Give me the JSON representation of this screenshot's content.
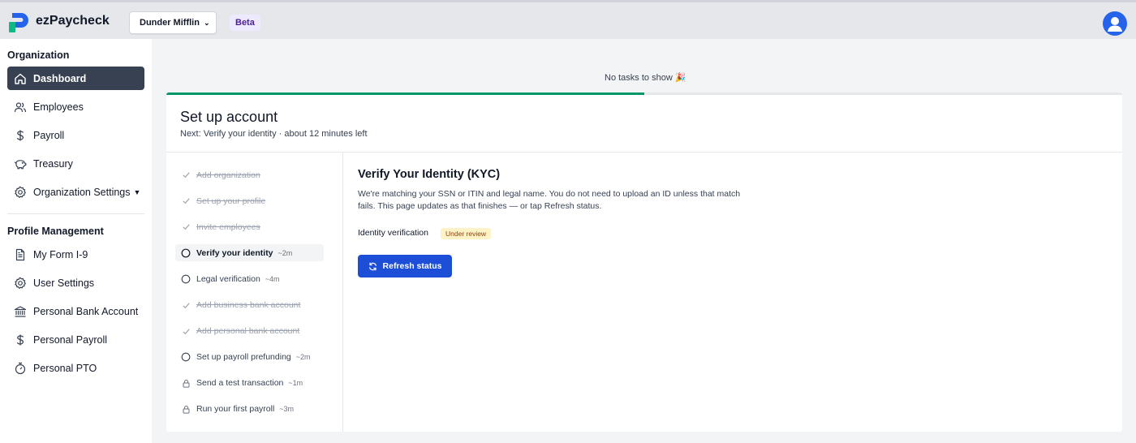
{
  "app": {
    "brand": "ezPaycheck",
    "org_select": "Dunder Mifflin",
    "beta_label": "Beta"
  },
  "colors": {
    "primary": "#1d4ed8",
    "active_nav": "#374151",
    "progress": "#059669",
    "badge_bg": "#fef3c7",
    "badge_text": "#92400e"
  },
  "sidebar": {
    "org_title": "Organization",
    "org_items": [
      {
        "label": "Dashboard",
        "icon": "home-icon"
      },
      {
        "label": "Employees",
        "icon": "users-icon"
      },
      {
        "label": "Payroll",
        "icon": "dollar-icon"
      },
      {
        "label": "Treasury",
        "icon": "piggy-bank-icon"
      },
      {
        "label": "Organization Settings",
        "icon": "gear-icon"
      }
    ],
    "profile_title": "Profile Management",
    "profile_items": [
      {
        "label": "My Form I-9",
        "icon": "document-icon"
      },
      {
        "label": "User Settings",
        "icon": "gear-icon"
      },
      {
        "label": "Personal Bank Account",
        "icon": "bank-icon"
      },
      {
        "label": "Personal Payroll",
        "icon": "dollar-icon"
      },
      {
        "label": "Personal PTO",
        "icon": "stopwatch-icon"
      }
    ]
  },
  "main": {
    "no_tasks": "No tasks to show 🎉",
    "setup": {
      "title": "Set up account",
      "subtitle": "Next: Verify your identity · about 12 minutes left",
      "progress_fraction": 0.5,
      "steps": [
        {
          "label": "Add organization",
          "status": "done",
          "time": ""
        },
        {
          "label": "Set up your profile",
          "status": "done",
          "time": ""
        },
        {
          "label": "Invite employees",
          "status": "done",
          "time": ""
        },
        {
          "label": "Verify your identity",
          "status": "current",
          "time": "~2m"
        },
        {
          "label": "Legal verification",
          "status": "todo",
          "time": "~4m"
        },
        {
          "label": "Add business bank account",
          "status": "done",
          "time": ""
        },
        {
          "label": "Add personal bank account",
          "status": "done",
          "time": ""
        },
        {
          "label": "Set up payroll prefunding",
          "status": "todo",
          "time": "~2m"
        },
        {
          "label": "Send a test transaction",
          "status": "locked",
          "time": "~1m"
        },
        {
          "label": "Run your first payroll",
          "status": "locked",
          "time": "~3m"
        }
      ]
    },
    "kyc": {
      "title": "Verify Your Identity (KYC)",
      "description": "We're matching your SSN or ITIN and legal name. You do not need to upload an ID unless that match fails. This page updates as that finishes — or tap Refresh status.",
      "status_label": "Identity verification",
      "status_badge": "Under review",
      "refresh_button": "Refresh status"
    }
  }
}
